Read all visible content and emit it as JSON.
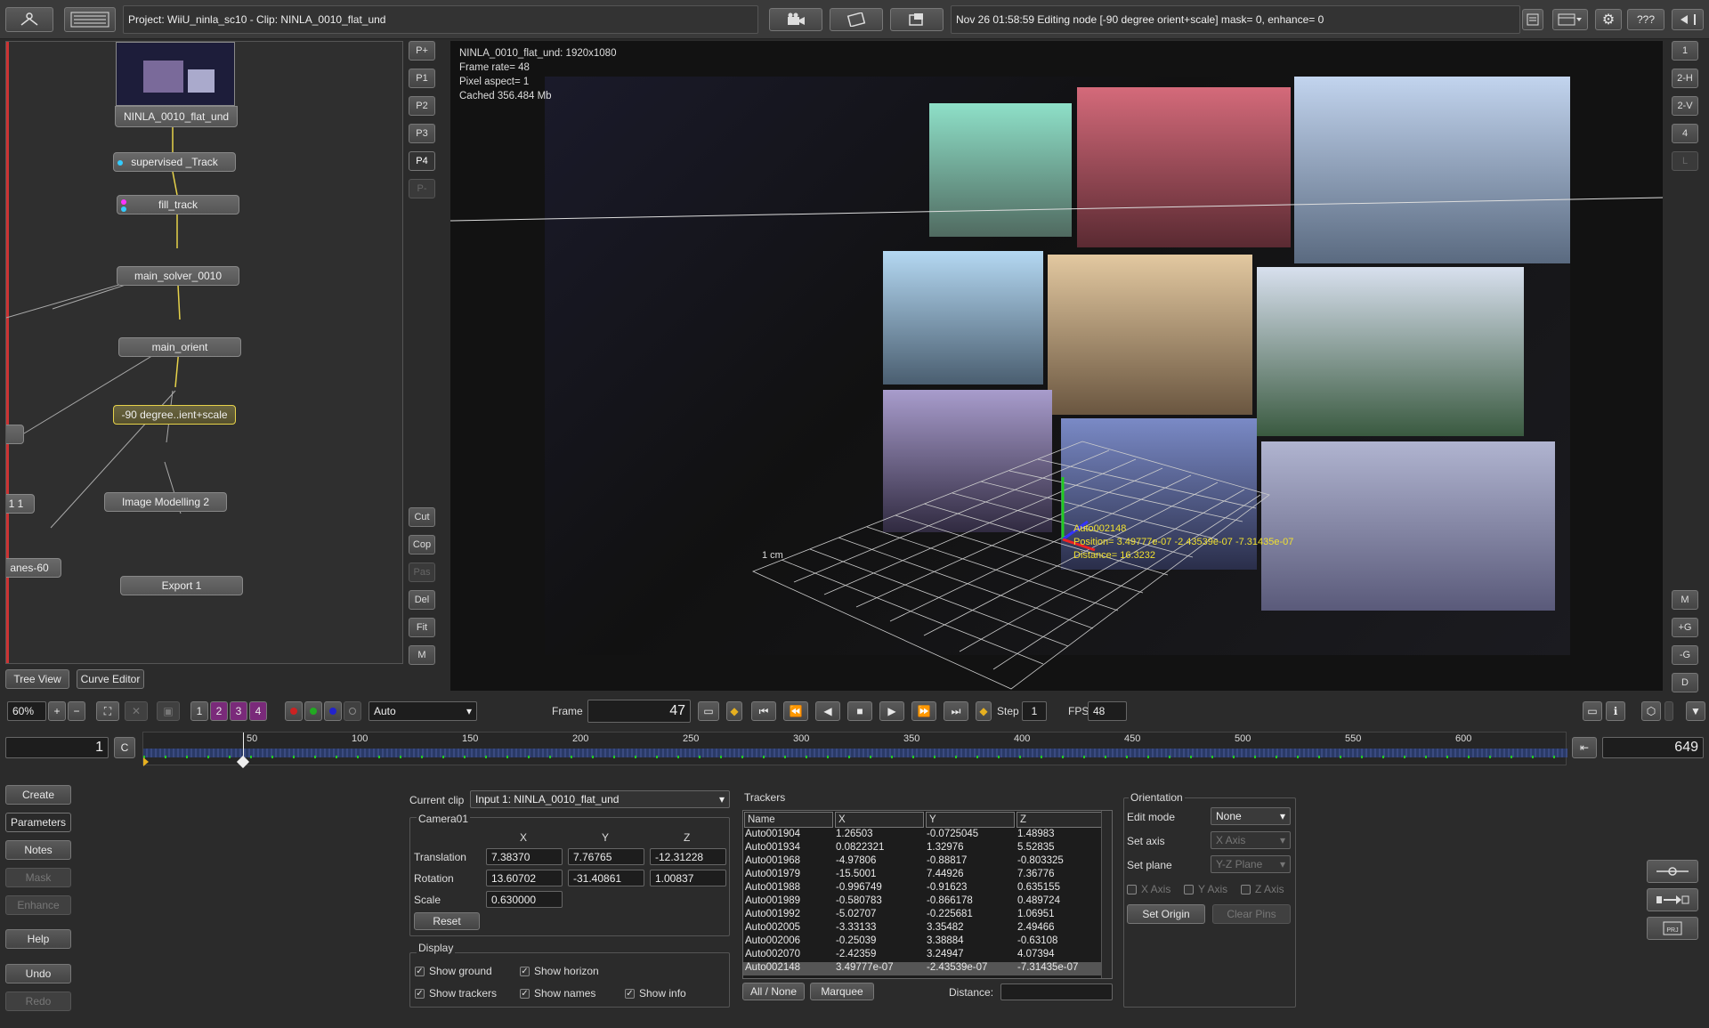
{
  "topbar": {
    "project_clip": "Project: WiiU_ninla_sc10 - Clip: NINLA_0010_flat_und",
    "status": "Nov 26 01:58:59 Editing node [-90 degree orient+scale] mask= 0, enhance= 0",
    "help_label": "???"
  },
  "tree": {
    "nodes": [
      {
        "label": "NINLA_0010_flat_und"
      },
      {
        "label": "supervised _Track"
      },
      {
        "label": "fill_track"
      },
      {
        "label": "main_solver_0010"
      },
      {
        "label": "main_orient"
      },
      {
        "label": "-90 degree..ient+scale"
      },
      {
        "label": "Image Modelling 2"
      },
      {
        "label": "Export 1"
      },
      {
        "label": "1 1"
      },
      {
        "label": "anes-60"
      }
    ],
    "tabs": {
      "tree_view": "Tree View",
      "curve_editor": "Curve Editor"
    }
  },
  "preset_buttons": [
    "P+",
    "P1",
    "P2",
    "P3",
    "P4",
    "P-"
  ],
  "edit_buttons": [
    "Cut",
    "Cop",
    "Pas",
    "Del",
    "Fit",
    "M"
  ],
  "right_buttons_top": [
    "1",
    "2-H",
    "2-V",
    "4",
    "L"
  ],
  "right_buttons_bottom": [
    "M",
    "+G",
    "-G",
    "D"
  ],
  "viewer": {
    "info_name": "NINLA_0010_flat_und: 1920x1080",
    "info_framerate": "Frame rate= 48",
    "info_aspect": "Pixel aspect= 1",
    "info_cached": "Cached 356.484 Mb",
    "scale_label": "1 cm",
    "tracker_label": "Auto002148",
    "tracker_position": "Position= 3.49777e-07 -2.43539e-07 -7.31435e-07",
    "tracker_distance": "Distance= 16.3232"
  },
  "transport": {
    "zoom": "60%",
    "view_nums": [
      "1",
      "2",
      "3",
      "4"
    ],
    "mode": "Auto",
    "frame_label": "Frame",
    "frame_value": "47",
    "step_label": "Step",
    "step_value": "1",
    "fps_label": "FPS",
    "fps_value": "48"
  },
  "timeline": {
    "start": "1",
    "c_label": "C",
    "end": "649",
    "ticks": [
      "50",
      "100",
      "150",
      "200",
      "250",
      "300",
      "350",
      "400",
      "450",
      "500",
      "550",
      "600"
    ]
  },
  "left_buttons": [
    "Create",
    "Parameters",
    "Notes",
    "Mask",
    "Enhance",
    "Help",
    "Undo",
    "Redo"
  ],
  "camera": {
    "current_clip_label": "Current clip",
    "current_clip_value": "Input 1: NINLA_0010_flat_und",
    "group_label": "Camera01",
    "col_x": "X",
    "col_y": "Y",
    "col_z": "Z",
    "translation_label": "Translation",
    "translation": [
      "7.38370",
      "7.76765",
      "-12.31228"
    ],
    "rotation_label": "Rotation",
    "rotation": [
      "13.60702",
      "-31.40861",
      "1.00837"
    ],
    "scale_label": "Scale",
    "scale": "0.630000",
    "reset_label": "Reset"
  },
  "display": {
    "group_label": "Display",
    "show_ground": "Show ground",
    "show_horizon": "Show horizon",
    "show_trackers": "Show trackers",
    "show_names": "Show names",
    "show_info": "Show info"
  },
  "trackers": {
    "group_label": "Trackers",
    "headers": [
      "Name",
      "X",
      "Y",
      "Z"
    ],
    "rows": [
      [
        "Auto001904",
        "1.26503",
        "-0.0725045",
        "1.48983"
      ],
      [
        "Auto001934",
        "0.0822321",
        "1.32976",
        "5.52835"
      ],
      [
        "Auto001968",
        "-4.97806",
        "-0.88817",
        "-0.803325"
      ],
      [
        "Auto001979",
        "-15.5001",
        "7.44926",
        "7.36776"
      ],
      [
        "Auto001988",
        "-0.996749",
        "-0.91623",
        "0.635155"
      ],
      [
        "Auto001989",
        "-0.580783",
        "-0.866178",
        "0.489724"
      ],
      [
        "Auto001992",
        "-5.02707",
        "-0.225681",
        "1.06951"
      ],
      [
        "Auto002005",
        "-3.33133",
        "3.35482",
        "2.49466"
      ],
      [
        "Auto002006",
        "-0.25039",
        "3.38884",
        "-0.63108"
      ],
      [
        "Auto002070",
        "-2.42359",
        "3.24947",
        "4.07394"
      ],
      [
        "Auto002148",
        "3.49777e-07",
        "-2.43539e-07",
        "-7.31435e-07"
      ]
    ],
    "all_none": "All / None",
    "marquee": "Marquee",
    "distance_label": "Distance:"
  },
  "orientation": {
    "group_label": "Orientation",
    "edit_mode_label": "Edit mode",
    "edit_mode_value": "None",
    "set_axis_label": "Set axis",
    "set_axis_value": "X Axis",
    "set_plane_label": "Set plane",
    "set_plane_value": "Y-Z Plane",
    "x_axis": "X Axis",
    "y_axis": "Y Axis",
    "z_axis": "Z Axis",
    "set_origin": "Set Origin",
    "clear_pins": "Clear Pins"
  }
}
